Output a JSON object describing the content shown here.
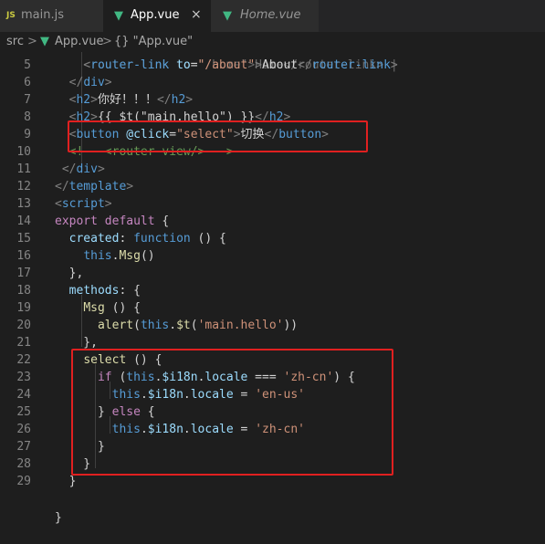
{
  "tabs": [
    {
      "icon": "JS",
      "label": "main.js",
      "active": false,
      "italic": false
    },
    {
      "icon": "vue-icon",
      "label": "App.vue",
      "active": true,
      "italic": false,
      "close": "×"
    },
    {
      "icon": "vue-icon",
      "label": "Home.vue",
      "active": false,
      "italic": true
    }
  ],
  "breadcrumb": {
    "folder": "src",
    "sep1": ">",
    "file": "App.vue",
    "sep2": ">",
    "symbol": "{} \"App.vue\""
  },
  "editor": {
    "lines": [
      {
        "num": "5",
        "tokens": [
          [
            "txt",
            "    "
          ],
          [
            "br",
            "<"
          ],
          [
            "tag",
            "router-link"
          ],
          [
            "txt",
            " "
          ],
          [
            "attr",
            "to"
          ],
          [
            "txt",
            "="
          ],
          [
            "str",
            "\"/about\""
          ],
          [
            "br",
            ">"
          ],
          [
            "txt",
            "About"
          ],
          [
            "br",
            "</"
          ],
          [
            "tag",
            "router-link"
          ],
          [
            "br",
            ">"
          ]
        ]
      },
      {
        "num": "6",
        "tokens": [
          [
            "txt",
            "  "
          ],
          [
            "br",
            "</"
          ],
          [
            "tag",
            "div"
          ],
          [
            "br",
            ">"
          ]
        ]
      },
      {
        "num": "7",
        "tokens": [
          [
            "txt",
            "  "
          ],
          [
            "br",
            "<"
          ],
          [
            "tag",
            "h2"
          ],
          [
            "br",
            ">"
          ],
          [
            "txt",
            "你好！！！"
          ],
          [
            "br",
            "</"
          ],
          [
            "tag",
            "h2"
          ],
          [
            "br",
            ">"
          ]
        ]
      },
      {
        "num": "8",
        "tokens": [
          [
            "txt",
            "  "
          ],
          [
            "br",
            "<"
          ],
          [
            "tag",
            "h2"
          ],
          [
            "br",
            ">"
          ],
          [
            "txt",
            "{{ $t(\"main.hello\") }}"
          ],
          [
            "br",
            "</"
          ],
          [
            "tag",
            "h2"
          ],
          [
            "br",
            ">"
          ]
        ]
      },
      {
        "num": "9",
        "tokens": [
          [
            "txt",
            "  "
          ],
          [
            "br",
            "<"
          ],
          [
            "tag",
            "button"
          ],
          [
            "txt",
            " "
          ],
          [
            "attr",
            "@click"
          ],
          [
            "txt",
            "="
          ],
          [
            "str",
            "\"select\""
          ],
          [
            "br",
            ">"
          ],
          [
            "txt",
            "切换"
          ],
          [
            "br",
            "</"
          ],
          [
            "tag",
            "button"
          ],
          [
            "br",
            ">"
          ]
        ]
      },
      {
        "num": "10",
        "tokens": [
          [
            "txt",
            "  "
          ],
          [
            "cmt",
            "<!-- <router-view/> -->"
          ]
        ]
      },
      {
        "num": "11",
        "tokens": [
          [
            "txt",
            " "
          ],
          [
            "br",
            "</"
          ],
          [
            "tag",
            "div"
          ],
          [
            "br",
            ">"
          ]
        ]
      },
      {
        "num": "12",
        "tokens": [
          [
            "br",
            "</"
          ],
          [
            "tag",
            "template"
          ],
          [
            "br",
            ">"
          ]
        ]
      },
      {
        "num": "13",
        "tokens": [
          [
            "br",
            "<"
          ],
          [
            "tag",
            "script"
          ],
          [
            "br",
            ">"
          ]
        ]
      },
      {
        "num": "14",
        "tokens": [
          [
            "kw",
            "export"
          ],
          [
            "txt",
            " "
          ],
          [
            "kw",
            "default"
          ],
          [
            "txt",
            " {"
          ]
        ]
      },
      {
        "num": "15",
        "tokens": [
          [
            "txt",
            "  "
          ],
          [
            "var",
            "created"
          ],
          [
            "txt",
            ": "
          ],
          [
            "blue",
            "function"
          ],
          [
            "txt",
            " () {"
          ]
        ]
      },
      {
        "num": "16",
        "tokens": [
          [
            "txt",
            "    "
          ],
          [
            "blue",
            "this"
          ],
          [
            "txt",
            "."
          ],
          [
            "fn",
            "Msg"
          ],
          [
            "txt",
            "()"
          ]
        ]
      },
      {
        "num": "17",
        "tokens": [
          [
            "txt",
            "  },"
          ]
        ]
      },
      {
        "num": "18",
        "tokens": [
          [
            "txt",
            "  "
          ],
          [
            "var",
            "methods"
          ],
          [
            "txt",
            ": {"
          ]
        ]
      },
      {
        "num": "19",
        "tokens": [
          [
            "txt",
            "    "
          ],
          [
            "fn",
            "Msg"
          ],
          [
            "txt",
            " () {"
          ]
        ]
      },
      {
        "num": "20",
        "tokens": [
          [
            "txt",
            "      "
          ],
          [
            "fn",
            "alert"
          ],
          [
            "txt",
            "("
          ],
          [
            "blue",
            "this"
          ],
          [
            "txt",
            "."
          ],
          [
            "fn",
            "$t"
          ],
          [
            "txt",
            "("
          ],
          [
            "str",
            "'main.hello'"
          ],
          [
            "txt",
            "))"
          ]
        ]
      },
      {
        "num": "21",
        "tokens": [
          [
            "txt",
            "    },"
          ]
        ]
      },
      {
        "num": "22",
        "tokens": [
          [
            "txt",
            "    "
          ],
          [
            "fn",
            "select"
          ],
          [
            "txt",
            " () {"
          ]
        ]
      },
      {
        "num": "23",
        "tokens": [
          [
            "txt",
            "      "
          ],
          [
            "kw",
            "if"
          ],
          [
            "txt",
            " ("
          ],
          [
            "blue",
            "this"
          ],
          [
            "txt",
            "."
          ],
          [
            "var",
            "$i18n"
          ],
          [
            "txt",
            "."
          ],
          [
            "var",
            "locale"
          ],
          [
            "txt",
            " === "
          ],
          [
            "str",
            "'zh-cn'"
          ],
          [
            "txt",
            ") {"
          ]
        ]
      },
      {
        "num": "24",
        "tokens": [
          [
            "txt",
            "        "
          ],
          [
            "blue",
            "this"
          ],
          [
            "txt",
            "."
          ],
          [
            "var",
            "$i18n"
          ],
          [
            "txt",
            "."
          ],
          [
            "var",
            "locale"
          ],
          [
            "txt",
            " = "
          ],
          [
            "str",
            "'en-us'"
          ]
        ]
      },
      {
        "num": "25",
        "tokens": [
          [
            "txt",
            "      } "
          ],
          [
            "kw",
            "else"
          ],
          [
            "txt",
            " {"
          ]
        ]
      },
      {
        "num": "26",
        "tokens": [
          [
            "txt",
            "        "
          ],
          [
            "blue",
            "this"
          ],
          [
            "txt",
            "."
          ],
          [
            "var",
            "$i18n"
          ],
          [
            "txt",
            "."
          ],
          [
            "var",
            "locale"
          ],
          [
            "txt",
            " = "
          ],
          [
            "str",
            "'zh-cn'"
          ]
        ]
      },
      {
        "num": "27",
        "tokens": [
          [
            "txt",
            "      }"
          ]
        ]
      },
      {
        "num": "28",
        "tokens": [
          [
            "txt",
            "    }"
          ]
        ]
      },
      {
        "num": "29",
        "tokens": [
          [
            "txt",
            "  }"
          ]
        ]
      }
    ]
  }
}
